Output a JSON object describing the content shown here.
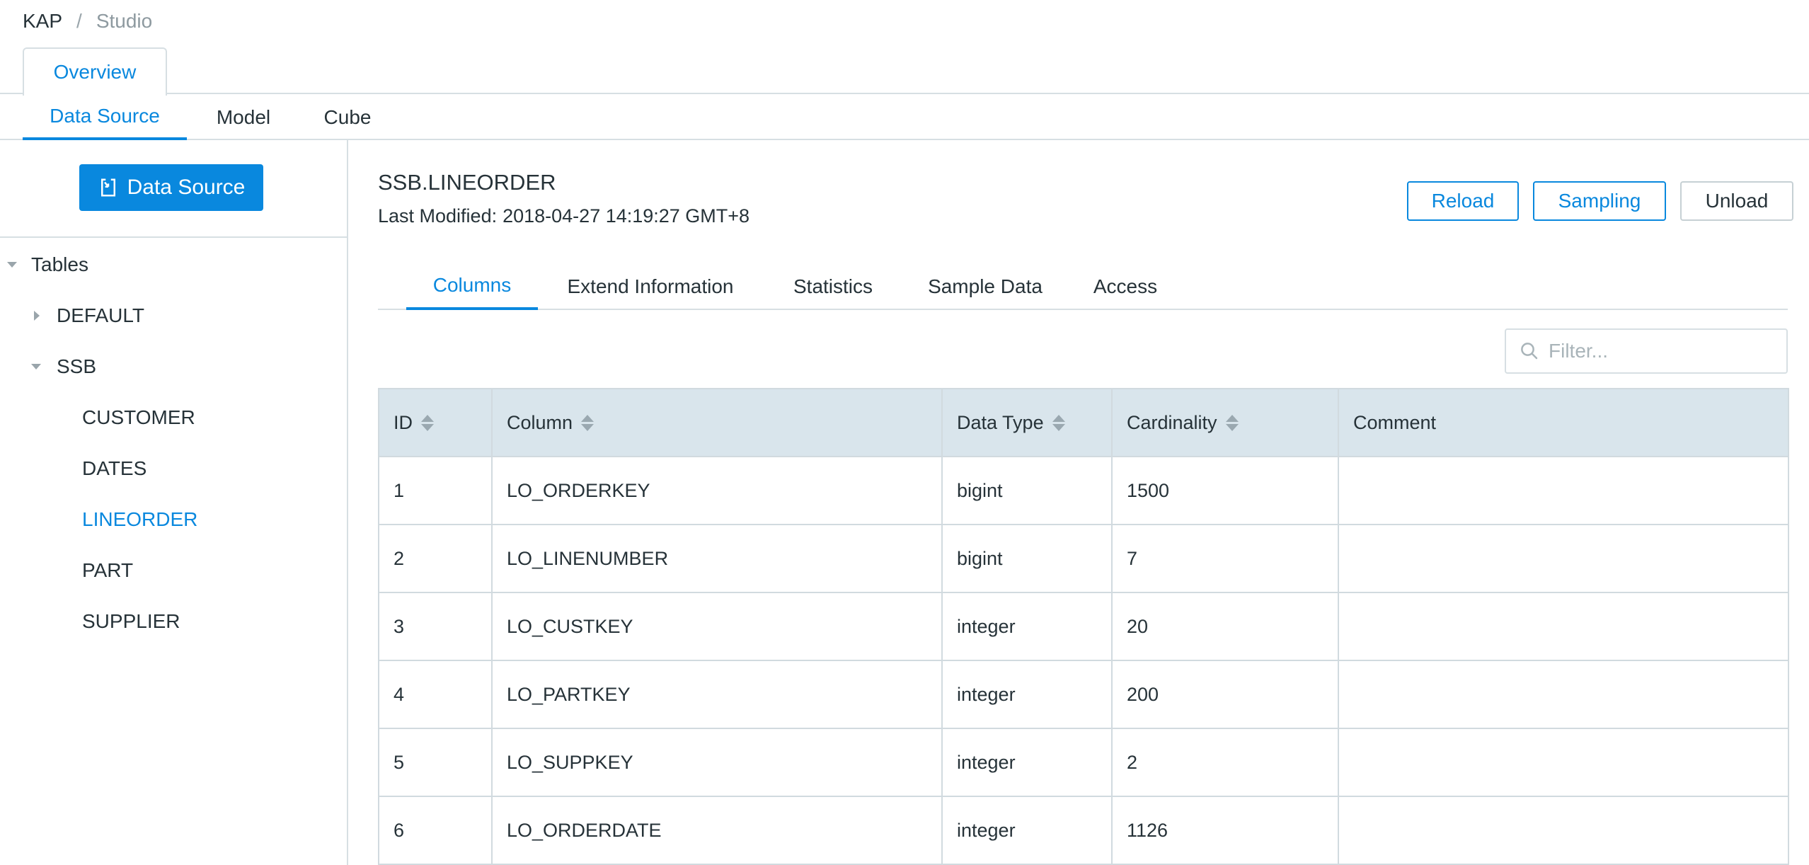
{
  "breadcrumb": {
    "root": "KAP",
    "separator": "/",
    "current": "Studio"
  },
  "top_tabs": [
    {
      "label": "Overview",
      "active": true
    }
  ],
  "sub_nav": [
    {
      "label": "Data Source",
      "active": true
    },
    {
      "label": "Model",
      "active": false
    },
    {
      "label": "Cube",
      "active": false
    }
  ],
  "sidebar": {
    "data_source_button": "Data Source",
    "tree": {
      "root": "Tables",
      "databases": [
        {
          "name": "DEFAULT",
          "expanded": false,
          "tables": []
        },
        {
          "name": "SSB",
          "expanded": true,
          "tables": [
            "CUSTOMER",
            "DATES",
            "LINEORDER",
            "PART",
            "SUPPLIER"
          ],
          "selected": "LINEORDER"
        }
      ]
    }
  },
  "main": {
    "title": "SSB.LINEORDER",
    "last_modified_label": "Last Modified:",
    "last_modified_value": "2018-04-27 14:19:27 GMT+8",
    "actions": {
      "reload": "Reload",
      "sampling": "Sampling",
      "unload": "Unload"
    },
    "tabs": [
      {
        "label": "Columns",
        "active": true
      },
      {
        "label": "Extend Information",
        "active": false
      },
      {
        "label": "Statistics",
        "active": false
      },
      {
        "label": "Sample Data",
        "active": false
      },
      {
        "label": "Access",
        "active": false
      }
    ],
    "filter": {
      "placeholder": "Filter...",
      "value": ""
    },
    "table": {
      "headers": [
        "ID",
        "Column",
        "Data Type",
        "Cardinality",
        "Comment"
      ],
      "rows": [
        [
          "1",
          "LO_ORDERKEY",
          "bigint",
          "1500",
          ""
        ],
        [
          "2",
          "LO_LINENUMBER",
          "bigint",
          "7",
          ""
        ],
        [
          "3",
          "LO_CUSTKEY",
          "integer",
          "20",
          ""
        ],
        [
          "4",
          "LO_PARTKEY",
          "integer",
          "200",
          ""
        ],
        [
          "5",
          "LO_SUPPKEY",
          "integer",
          "2",
          ""
        ],
        [
          "6",
          "LO_ORDERDATE",
          "integer",
          "1126",
          ""
        ]
      ]
    }
  },
  "colors": {
    "accent": "#0988de",
    "header_bg": "#d9e5ec",
    "border": "#d1dadf",
    "text": "#263238",
    "muted": "#8e9aa0"
  }
}
